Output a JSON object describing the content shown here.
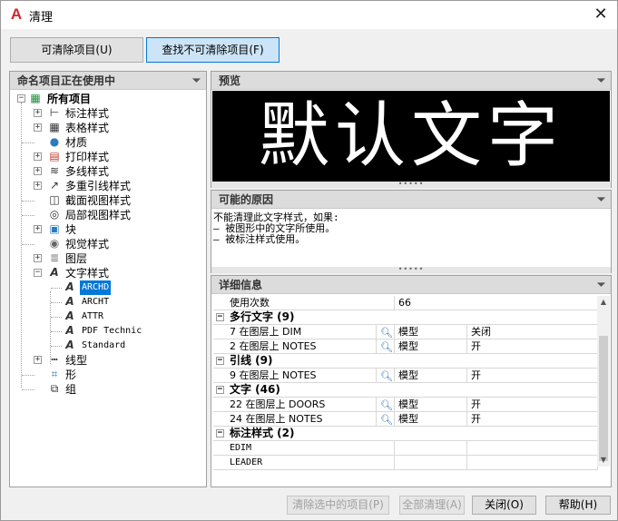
{
  "window": {
    "title": "清理",
    "app_icon": "A"
  },
  "tabs": [
    "可清除项目(U)",
    "查找不可清除项目(F)"
  ],
  "tree_panel": {
    "title": "命名项目正在使用中",
    "root": "所有项目",
    "items": [
      "标注样式",
      "表格样式",
      "材质",
      "打印样式",
      "多线样式",
      "多重引线样式",
      "截面视图样式",
      "局部视图样式",
      "块",
      "视觉样式",
      "图层",
      "文字样式",
      "线型",
      "形",
      "组"
    ],
    "text_styles": [
      "ARCHD",
      "ARCHT",
      "ATTR",
      "PDF Technic",
      "Standard"
    ]
  },
  "preview": {
    "title": "预览",
    "text": "默认文字"
  },
  "reasons": {
    "title": "可能的原因",
    "lines": [
      "不能清理此文字样式，如果:",
      "— 被图形中的文字所使用。",
      "— 被标注样式使用。"
    ]
  },
  "details": {
    "title": "详细信息",
    "usage_label": "使用次数",
    "usage_value": "66",
    "groups": [
      {
        "name": "多行文字 (9)",
        "rows": [
          {
            "label": "7 在图层上 DIM",
            "space": "模型",
            "state": "关闭"
          },
          {
            "label": "2 在图层上 NOTES",
            "space": "模型",
            "state": "开"
          }
        ]
      },
      {
        "name": "引线 (9)",
        "rows": [
          {
            "label": "9 在图层上 NOTES",
            "space": "模型",
            "state": "开"
          }
        ]
      },
      {
        "name": "文字 (46)",
        "rows": [
          {
            "label": "22 在图层上 DOORS",
            "space": "模型",
            "state": "开"
          },
          {
            "label": "24 在图层上 NOTES",
            "space": "模型",
            "state": "开"
          }
        ]
      },
      {
        "name": "标注样式 (2)",
        "rows": [
          {
            "label": "EDIM",
            "space": "",
            "state": ""
          },
          {
            "label": "LEADER",
            "space": "",
            "state": ""
          }
        ]
      }
    ]
  },
  "buttons": {
    "purge_selected": "清除选中的项目(P)",
    "purge_all": "全部清理(A)",
    "close": "关闭(O)",
    "help": "帮助(H)"
  }
}
